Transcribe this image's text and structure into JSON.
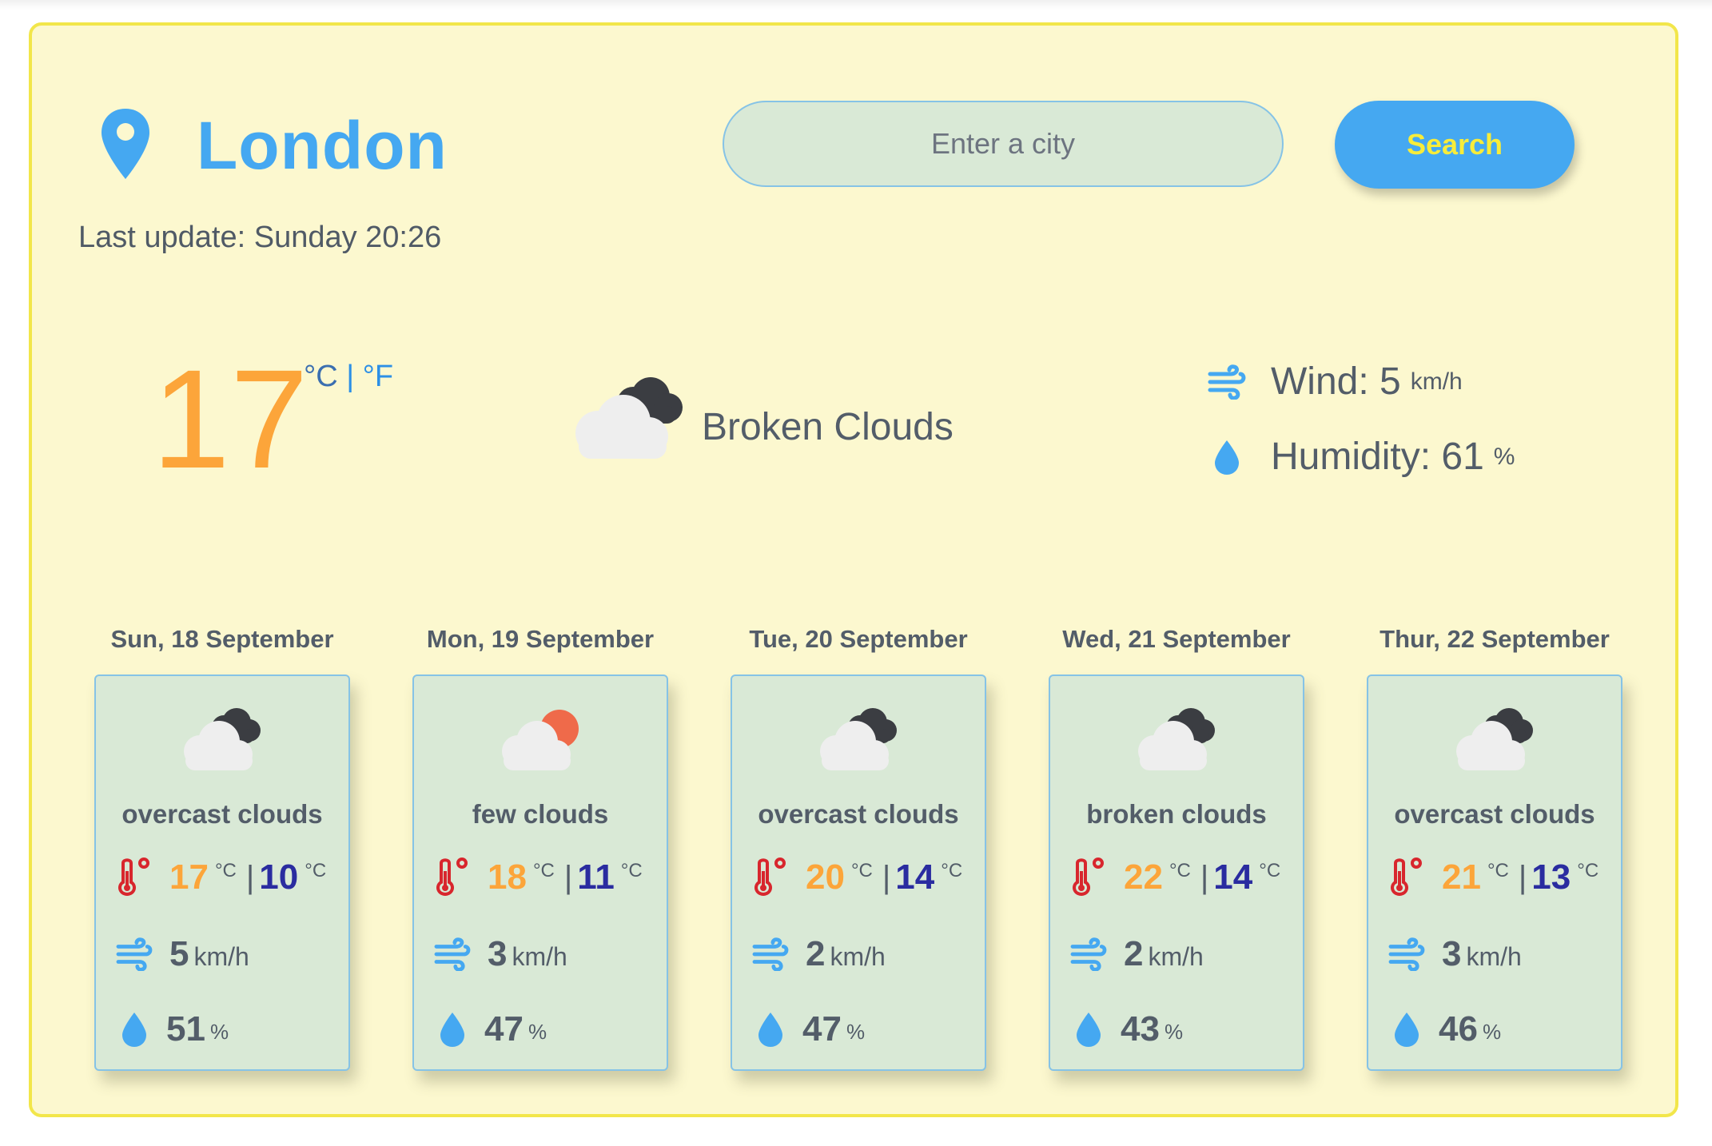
{
  "header": {
    "city": "London",
    "last_update": "Last update: Sunday 20:26"
  },
  "search": {
    "placeholder": "Enter a city",
    "button_label": "Search"
  },
  "current": {
    "temperature": "17",
    "unit_c": "°C",
    "separator": "|",
    "unit_f": "°F",
    "condition": "Broken Clouds",
    "condition_icon": "broken-clouds-icon",
    "wind_label": "Wind: 5",
    "wind_unit": "km/h",
    "humidity_label": "Humidity: 61",
    "humidity_unit": "%"
  },
  "forecast": [
    {
      "date": "Sun, 18 September",
      "icon": "overcast-clouds-icon",
      "desc": "overcast clouds",
      "max": "17",
      "min": "10",
      "unit": "°C",
      "sep": "|",
      "wind": "5",
      "wind_unit": "km/h",
      "humidity": "51",
      "humidity_unit": "%"
    },
    {
      "date": "Mon, 19 September",
      "icon": "few-clouds-icon",
      "desc": "few clouds",
      "max": "18",
      "min": "11",
      "unit": "°C",
      "sep": "|",
      "wind": "3",
      "wind_unit": "km/h",
      "humidity": "47",
      "humidity_unit": "%"
    },
    {
      "date": "Tue, 20 September",
      "icon": "overcast-clouds-icon",
      "desc": "overcast clouds",
      "max": "20",
      "min": "14",
      "unit": "°C",
      "sep": "|",
      "wind": "2",
      "wind_unit": "km/h",
      "humidity": "47",
      "humidity_unit": "%"
    },
    {
      "date": "Wed, 21 September",
      "icon": "broken-clouds-icon",
      "desc": "broken clouds",
      "max": "22",
      "min": "14",
      "unit": "°C",
      "sep": "|",
      "wind": "2",
      "wind_unit": "km/h",
      "humidity": "43",
      "humidity_unit": "%"
    },
    {
      "date": "Thur, 22 September",
      "icon": "overcast-clouds-icon",
      "desc": "overcast clouds",
      "max": "21",
      "min": "13",
      "unit": "°C",
      "sep": "|",
      "wind": "3",
      "wind_unit": "km/h",
      "humidity": "46",
      "humidity_unit": "%"
    }
  ],
  "colors": {
    "accent": "#45a8f1",
    "background": "#fcf8cf",
    "border": "#f2e64a",
    "temp_max": "#fca53a",
    "temp_min": "#2a2ca0",
    "card": "#d9e9d6",
    "thermometer": "#d8262d"
  }
}
